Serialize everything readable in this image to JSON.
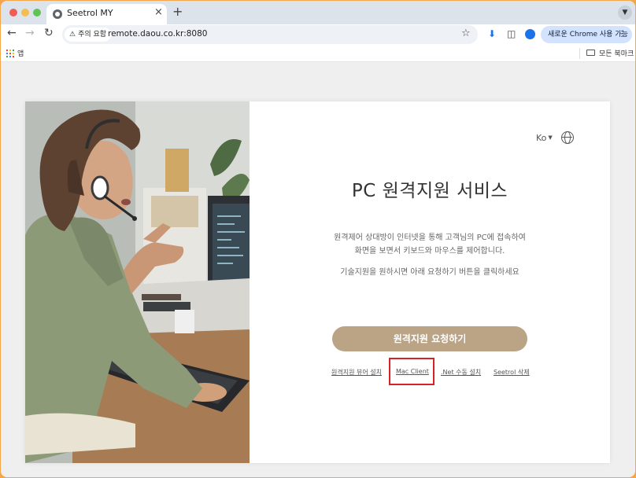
{
  "browser": {
    "tab_title": "Seetrol MY",
    "tab_close": "×",
    "new_tab": "+",
    "security_chip": "주의 요함",
    "url": "remote.daou.co.kr:8080",
    "update_button": "새로운 Chrome 사용 가능",
    "bookmarks_apps": "앱",
    "all_bookmarks": "모든 북마크"
  },
  "page": {
    "language": "Ko",
    "title": "PC 원격지원 서비스",
    "description_line1": "원격제어 상대방이 인터넷을 통해 고객님의 PC에 접속하여",
    "description_line2": "화면을 보면서 키보드와 마우스를 제어합니다.",
    "instruction": "기술지원을 원하시면 아래 요청하기 버튼을 클릭하세요",
    "request_button": "원격지원 요청하기",
    "links": {
      "viewer_install": "원격지원 뷰어 설치",
      "mac_client": "Mac Client",
      "net_manual_install": ".Net 수동 설치",
      "seetrol_delete": "Seetrol 삭제"
    }
  },
  "colors": {
    "request_button": "#bba486",
    "highlight": "#d62222"
  },
  "icons": [
    "back-icon",
    "forward-icon",
    "reload-icon",
    "warning-icon",
    "star-icon",
    "download-icon",
    "sidepanel-icon",
    "profile-icon",
    "apps-grid-icon",
    "folder-icon",
    "globe-icon"
  ]
}
